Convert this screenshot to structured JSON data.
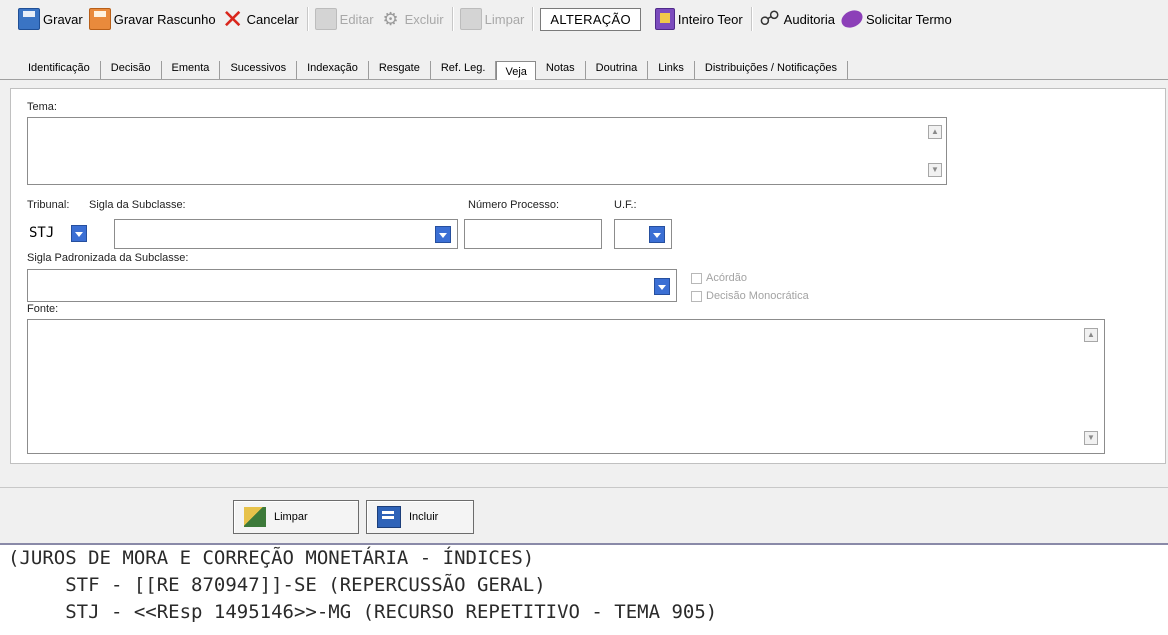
{
  "toolbar": {
    "save_label": "Gravar",
    "save_draft_label": "Gravar Rascunho",
    "cancel_label": "Cancelar",
    "edit_label": "Editar",
    "delete_label": "Excluir",
    "clear_label": "Limpar",
    "status": "ALTERAÇÃO",
    "full_text_label": "Inteiro Teor",
    "audit_label": "Auditoria",
    "request_term_label": "Solicitar Termo"
  },
  "tabs": [
    {
      "label": "Identificação",
      "active": false
    },
    {
      "label": "Decisão",
      "active": false
    },
    {
      "label": "Ementa",
      "active": false
    },
    {
      "label": "Sucessivos",
      "active": false
    },
    {
      "label": "Indexação",
      "active": false
    },
    {
      "label": "Resgate",
      "active": false
    },
    {
      "label": "Ref. Leg.",
      "active": false
    },
    {
      "label": "Veja",
      "active": true
    },
    {
      "label": "Notas",
      "active": false
    },
    {
      "label": "Doutrina",
      "active": false
    },
    {
      "label": "Links",
      "active": false
    },
    {
      "label": "Distribuições / Notificações",
      "active": false
    }
  ],
  "form": {
    "tema_label": "Tema:",
    "tema_value": "",
    "tribunal_label": "Tribunal:",
    "tribunal_value": "STJ",
    "sigla_subclasse_label": "Sigla da Subclasse:",
    "sigla_subclasse_value": "",
    "numero_processo_label": "Número Processo:",
    "numero_processo_value": "",
    "uf_label": "U.F.:",
    "uf_value": "",
    "sigla_padronizada_label": "Sigla Padronizada da Subclasse:",
    "sigla_padronizada_value": "",
    "acordao_label": "Acórdão",
    "decisao_monocratica_label": "Decisão Monocrática",
    "fonte_label": "Fonte:",
    "fonte_value": ""
  },
  "actions": {
    "limpar_label": "Limpar",
    "incluir_label": "Incluir"
  },
  "output_lines": [
    "(JUROS DE MORA E CORREÇÃO MONETÁRIA - ÍNDICES)",
    "     STF - [[RE 870947]]-SE (REPERCUSSÃO GERAL)",
    "     STJ - <<REsp 1495146>>-MG (RECURSO REPETITIVO - TEMA 905)"
  ]
}
